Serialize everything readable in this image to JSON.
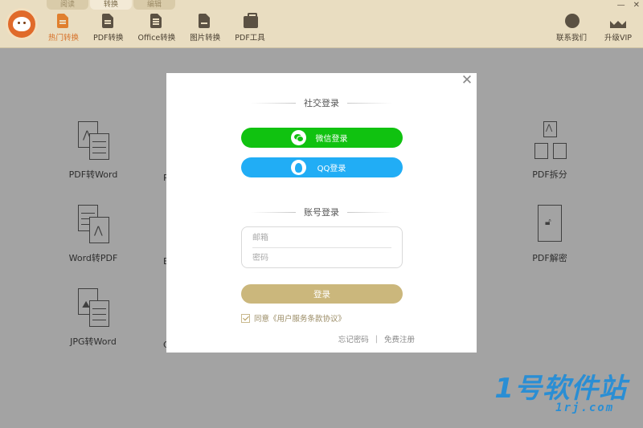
{
  "top_tabs": [
    {
      "label": "阅读",
      "active": false
    },
    {
      "label": "转换",
      "active": true
    },
    {
      "label": "编辑",
      "active": false
    }
  ],
  "toolbar": {
    "items": [
      {
        "label": "热门转换",
        "icon": "hot-icon",
        "active": true
      },
      {
        "label": "PDF转换",
        "icon": "pdf-icon",
        "active": false
      },
      {
        "label": "Office转换",
        "icon": "office-icon",
        "active": false
      },
      {
        "label": "图片转换",
        "icon": "image-icon",
        "active": false
      },
      {
        "label": "PDF工具",
        "icon": "toolbox-icon",
        "active": false
      }
    ],
    "contact_label": "联系我们",
    "vip_label": "升级VIP"
  },
  "background_tiles": {
    "pdf_to_word": "PDF转Word",
    "word_to_pdf": "Word转PDF",
    "jpg_to_word": "JPG转Word",
    "pdf_split": "PDF拆分",
    "pdf_unlock": "PDF解密",
    "partial_1": "P",
    "partial_2": "E",
    "partial_3": "C"
  },
  "login_modal": {
    "social_title": "社交登录",
    "wechat_label": "微信登录",
    "qq_label": "QQ登录",
    "account_title": "账号登录",
    "email_placeholder": "邮箱",
    "password_placeholder": "密码",
    "login_button": "登录",
    "agree_text": "同意《用户服务条款协议》",
    "agree_checked": true,
    "forgot_password": "忘记密码",
    "separator": "|",
    "register": "免费注册"
  },
  "watermark": {
    "main": "1号软件站",
    "sub": "1rj.com"
  },
  "colors": {
    "toolbar_bg": "#e9ddc1",
    "overlay_bg": "#a3a3a3",
    "wechat_green": "#10c210",
    "qq_blue": "#21adf5",
    "login_gold": "#cbb77c",
    "accent_orange": "#e07f2e"
  }
}
